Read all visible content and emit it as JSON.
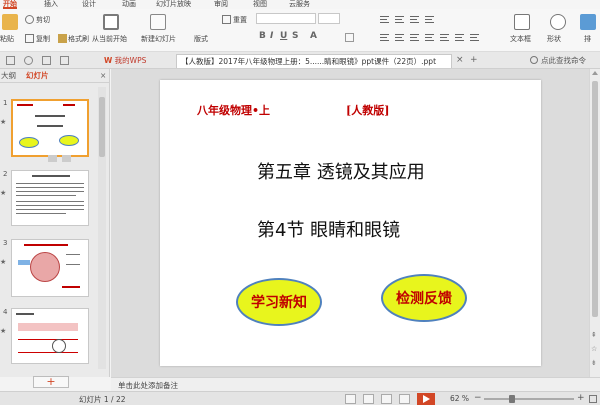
{
  "menu": {
    "tabs": [
      "开始",
      "插入",
      "设计",
      "幻灯片放映",
      "审阅",
      "视图",
      "云服务"
    ],
    "active_tab": "开始"
  },
  "ribbon": {
    "paste": "粘贴",
    "cut": "剪切",
    "copy": "复制",
    "format_painter": "格式刷",
    "from_current": "从当前开始",
    "new_slide": "新建幻灯片",
    "layout": "版式",
    "reset": "重置",
    "textbox": "文本框",
    "shape": "形状",
    "arrange": "排"
  },
  "search": {
    "placeholder": "点此查找命令"
  },
  "doc_tabs": {
    "wps": "我的WPS",
    "active": "【人教版】2017年八年级物理上册：5......睛和眼镜》ppt课件（22页）.ppt"
  },
  "left_panel": {
    "tab_outline": "大纲",
    "tab_slides": "幻灯片",
    "add_slide": "+",
    "thumbnails": [
      {
        "num": "1"
      },
      {
        "num": "2"
      },
      {
        "num": "3"
      },
      {
        "num": "4"
      }
    ]
  },
  "slide": {
    "header_left": "八年级物理•上",
    "header_right": "[人教版]",
    "chapter": "第五章   透镜及其应用",
    "section": "第4节   眼睛和眼镜",
    "btn_learn": "学习新知",
    "btn_check": "检测反馈"
  },
  "notes": {
    "placeholder": "单击此处添加备注"
  },
  "status": {
    "slide_counter": "幻灯片 1 / 22",
    "zoom": "62 %",
    "zoom_level": 0.62
  },
  "colors": {
    "accent": "#d24726",
    "slide_red": "#c00000",
    "oval_fill": "#e8f51d",
    "oval_border": "#4f81bd"
  }
}
